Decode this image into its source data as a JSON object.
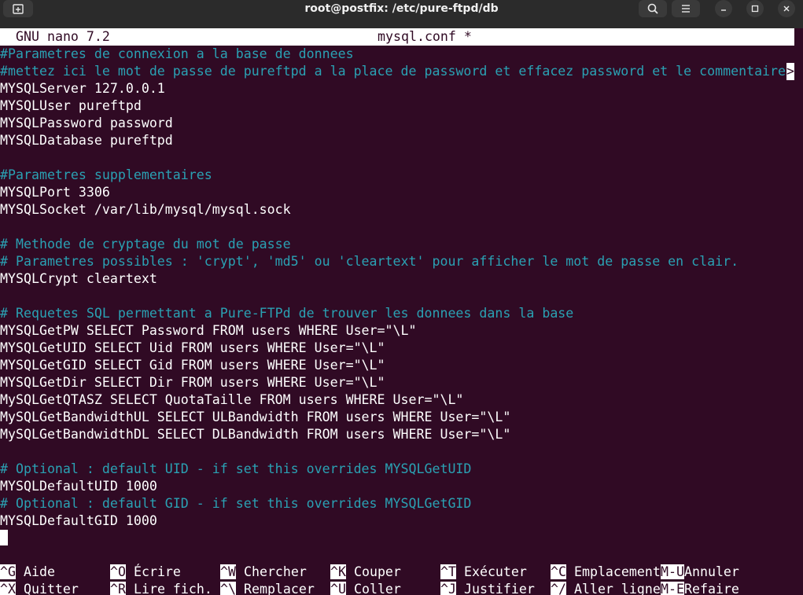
{
  "window": {
    "title": "root@postfix: /etc/pure-ftpd/db"
  },
  "nano": {
    "version": "GNU nano 7.2",
    "filename": "mysql.conf *",
    "truncation_marker": ">"
  },
  "lines": [
    {
      "text": "#Parametres de connexion a la base de donnees",
      "kind": "comment"
    },
    {
      "text": "#mettez ici le mot de passe de pureftpd a la place de password et effacez password et le commentaire",
      "kind": "comment"
    },
    {
      "text": "MYSQLServer 127.0.0.1",
      "kind": "normal"
    },
    {
      "text": "MYSQLUser pureftpd",
      "kind": "normal"
    },
    {
      "text": "MYSQLPassword password",
      "kind": "normal"
    },
    {
      "text": "MYSQLDatabase pureftpd",
      "kind": "normal"
    },
    {
      "text": "",
      "kind": "normal"
    },
    {
      "text": "#Parametres supplementaires",
      "kind": "comment"
    },
    {
      "text": "MYSQLPort 3306",
      "kind": "normal"
    },
    {
      "text": "MYSQLSocket /var/lib/mysql/mysql.sock",
      "kind": "normal"
    },
    {
      "text": "",
      "kind": "normal"
    },
    {
      "text": "# Methode de cryptage du mot de passe",
      "kind": "comment"
    },
    {
      "text": "# Parametres possibles : 'crypt', 'md5' ou 'cleartext' pour afficher le mot de passe en clair.",
      "kind": "comment"
    },
    {
      "text": "MYSQLCrypt cleartext",
      "kind": "normal"
    },
    {
      "text": "",
      "kind": "normal"
    },
    {
      "text": "# Requetes SQL permettant a Pure-FTPd de trouver les donnees dans la base",
      "kind": "comment"
    },
    {
      "text": "MYSQLGetPW SELECT Password FROM users WHERE User=\"\\L\"",
      "kind": "normal"
    },
    {
      "text": "MYSQLGetUID SELECT Uid FROM users WHERE User=\"\\L\"",
      "kind": "normal"
    },
    {
      "text": "MYSQLGetGID SELECT Gid FROM users WHERE User=\"\\L\"",
      "kind": "normal"
    },
    {
      "text": "MYSQLGetDir SELECT Dir FROM users WHERE User=\"\\L\"",
      "kind": "normal"
    },
    {
      "text": "MySQLGetQTASZ SELECT QuotaTaille FROM users WHERE User=\"\\L\"",
      "kind": "normal"
    },
    {
      "text": "MySQLGetBandwidthUL SELECT ULBandwidth FROM users WHERE User=\"\\L\"",
      "kind": "normal"
    },
    {
      "text": "MySQLGetBandwidthDL SELECT DLBandwidth FROM users WHERE User=\"\\L\"",
      "kind": "normal"
    },
    {
      "text": "",
      "kind": "normal"
    },
    {
      "text": "# Optional : default UID - if set this overrides MYSQLGetUID",
      "kind": "comment"
    },
    {
      "text": "MYSQLDefaultUID 1000",
      "kind": "normal"
    },
    {
      "text": "# Optional : default GID - if set this overrides MYSQLGetGID",
      "kind": "comment"
    },
    {
      "text": "MYSQLDefaultGID 1000",
      "kind": "normal"
    }
  ],
  "shortcuts": {
    "row1": [
      {
        "key": "^G",
        "label": "Aide"
      },
      {
        "key": "^O",
        "label": "Écrire"
      },
      {
        "key": "^W",
        "label": "Chercher"
      },
      {
        "key": "^K",
        "label": "Couper"
      },
      {
        "key": "^T",
        "label": "Exécuter"
      },
      {
        "key": "^C",
        "label": "Emplacement"
      },
      {
        "key": "M-U",
        "label": "Annuler"
      }
    ],
    "row2": [
      {
        "key": "^X",
        "label": "Quitter"
      },
      {
        "key": "^R",
        "label": "Lire fich."
      },
      {
        "key": "^\\",
        "label": "Remplacer"
      },
      {
        "key": "^U",
        "label": "Coller"
      },
      {
        "key": "^J",
        "label": "Justifier"
      },
      {
        "key": "^/",
        "label": "Aller ligne"
      },
      {
        "key": "M-E",
        "label": "Refaire"
      }
    ]
  },
  "icons": {
    "new_tab": "new-tab-icon",
    "search": "search-icon",
    "menu": "hamburger-menu-icon",
    "minimize": "minimize-icon",
    "maximize": "maximize-icon",
    "close": "close-icon"
  },
  "colors": {
    "terminal_bg": "#300a24",
    "comment": "#2aa1b3",
    "text": "#ffffff",
    "titlebar": "#2b2b2b"
  }
}
